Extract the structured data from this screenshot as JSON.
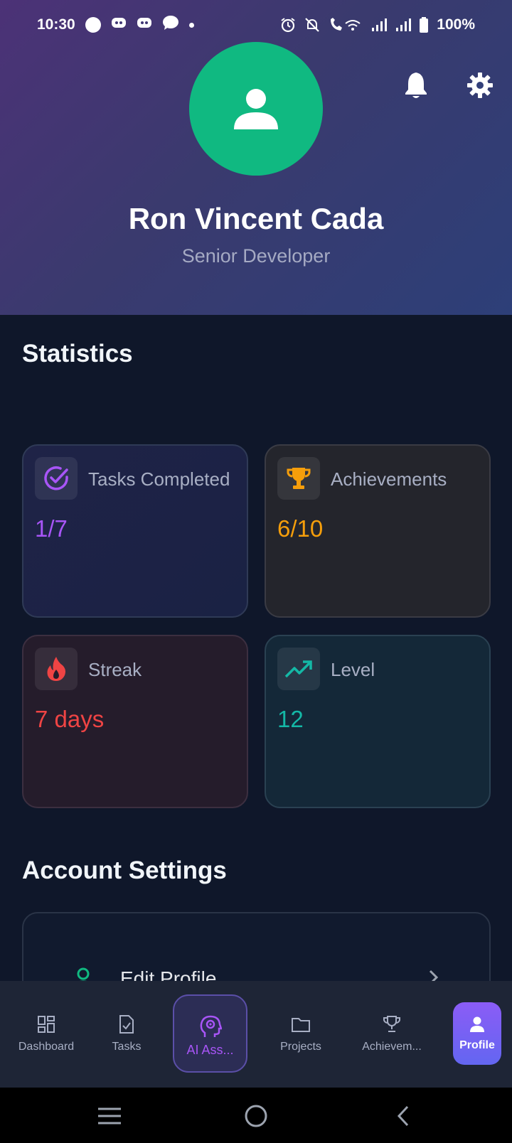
{
  "status_bar": {
    "time": "10:30",
    "battery": "100%"
  },
  "profile": {
    "name": "Ron Vincent Cada",
    "role": "Senior Developer",
    "avatar_color": "#10b981"
  },
  "statistics": {
    "title": "Statistics",
    "cards": [
      {
        "label": "Tasks Completed",
        "value": "1/7",
        "icon": "check-circle-icon",
        "color": "#a855f7"
      },
      {
        "label": "Achievements",
        "value": "6/10",
        "icon": "trophy-icon",
        "color": "#f59e0b"
      },
      {
        "label": "Streak",
        "value": "7 days",
        "icon": "flame-icon",
        "color": "#ef4444"
      },
      {
        "label": "Level",
        "value": "12",
        "icon": "trending-up-icon",
        "color": "#14b8a6"
      }
    ]
  },
  "account_settings": {
    "title": "Account Settings",
    "items": [
      {
        "label": "Edit Profile",
        "icon": "user-icon"
      }
    ]
  },
  "bottom_nav": {
    "items": [
      {
        "label": "Dashboard",
        "icon": "dashboard-icon"
      },
      {
        "label": "Tasks",
        "icon": "tasks-icon"
      },
      {
        "label": "AI Ass...",
        "icon": "ai-head-icon"
      },
      {
        "label": "Projects",
        "icon": "folder-icon"
      },
      {
        "label": "Achievem...",
        "icon": "trophy-icon"
      },
      {
        "label": "Profile",
        "icon": "user-icon"
      }
    ],
    "active": "Profile"
  }
}
